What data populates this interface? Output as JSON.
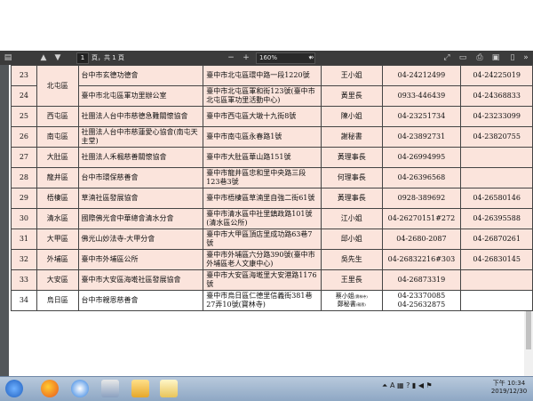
{
  "toolbar": {
    "page_current": "1",
    "page_total": "頁，共 1 頁",
    "zoom_minus": "−",
    "zoom_plus": "+",
    "zoom": "160%"
  },
  "rows": [
    {
      "no": "23",
      "district": "北屯區",
      "name": "台中市玄德功德會",
      "address": "臺中市北屯區環中路一段1220號",
      "contact": "王小姐",
      "phone": "04-24212499",
      "fax": "04-24225019",
      "bg": "pink"
    },
    {
      "no": "24",
      "district": "",
      "name": "臺中市北屯區軍功里辦公室",
      "address": "臺中市北屯區軍和街123號(臺中市北屯區軍功里活動中心)",
      "contact": "黃里長",
      "phone": "0933-446439",
      "fax": "04-24368833",
      "bg": "pink"
    },
    {
      "no": "25",
      "district": "西屯區",
      "name": "社團法人台中市慈德急難關懷協會",
      "address": "臺中市西屯區大墩十九街8號",
      "contact": "陳小姐",
      "phone": "04-23251734",
      "fax": "04-23233099",
      "bg": "pink"
    },
    {
      "no": "26",
      "district": "南屯區",
      "name": "社團法人台中市慈蓮愛心協會(南屯天主堂)",
      "address": "臺中市南屯區永春路1號",
      "contact": "謝秘書",
      "phone": "04-23892731",
      "fax": "04-23820755",
      "bg": "pink"
    },
    {
      "no": "27",
      "district": "大肚區",
      "name": "社團法人禾楓慈善關懷協會",
      "address": "臺中市大肚區華山路151號",
      "contact": "黃理事長",
      "phone": "04-26994995",
      "fax": "",
      "bg": "pink"
    },
    {
      "no": "28",
      "district": "龍井區",
      "name": "台中市環保慈善會",
      "address": "臺中市龍井區忠和里中央路三段123巷3號",
      "contact": "何理事長",
      "phone": "04-26396568",
      "fax": "",
      "bg": "pink"
    },
    {
      "no": "29",
      "district": "梧棲區",
      "name": "草湳社區發展協會",
      "address": "臺中市梧棲區草湳里自強二街61號",
      "contact": "黃理事長",
      "phone": "0928-389692",
      "fax": "04-26580146",
      "bg": "pink"
    },
    {
      "no": "30",
      "district": "清水區",
      "name": "國際佛光會中華總會清水分會",
      "address": "臺中市清水區中社里鎮政路101號(清水區公所)",
      "contact": "江小姐",
      "phone": "04-26270151#272",
      "fax": "04-26395588",
      "bg": "pink"
    },
    {
      "no": "31",
      "district": "大甲區",
      "name": "佛光山妙法寺-大甲分會",
      "address": "臺中市大甲區頂店里成功路63巷7號",
      "contact": "邱小姐",
      "phone": "04-2680-2087",
      "fax": "04-26870261",
      "bg": "pink"
    },
    {
      "no": "32",
      "district": "外埔區",
      "name": "臺中市外埔區公所",
      "address": "臺中市外埔區六分路390號(臺中市外埔區老人文康中心)",
      "contact": "吳先生",
      "phone": "04-26832216#303",
      "fax": "04-26830145",
      "bg": "pink"
    },
    {
      "no": "33",
      "district": "大安區",
      "name": "臺中市大安區海墘社區發展協會",
      "address": "臺中市大安區海墘里大安港路1176號",
      "contact": "王里長",
      "phone": "04-26873319",
      "fax": "",
      "bg": "pink"
    },
    {
      "no": "34",
      "district": "烏日區",
      "name": "台中市親恩慈善會",
      "address": "臺中市烏日區仁德里信義街381巷27弄10號(寶林寺)",
      "contact": "蔡小姐",
      "contact_note": "(寶林寺)",
      "contact2": "鄭秘書",
      "contact2_note": "(親恩)",
      "phone": "04-23370085",
      "phone2": "04-25632875",
      "fax": "",
      "bg": "white"
    }
  ],
  "taskbar": {
    "icons": [
      "windows-start-icon",
      "firefox-icon",
      "media-player-icon",
      "paint-icon",
      "file-explorer-icon",
      "image-editor-icon"
    ],
    "time": "下午 10:34",
    "date": "2019/12/30"
  },
  "colors": {
    "row_pink": "#fbe4dc",
    "toolbar": "#3b3b3b",
    "viewer_bg": "#525659"
  }
}
